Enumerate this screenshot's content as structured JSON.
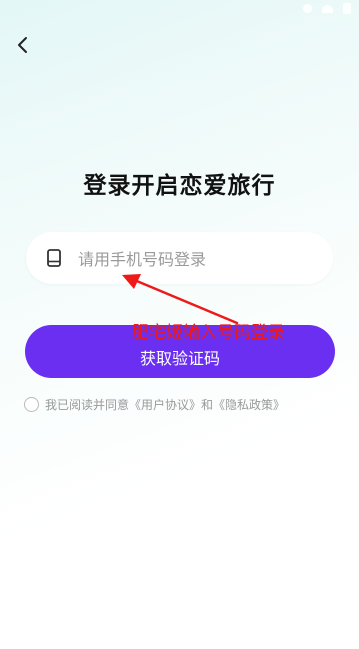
{
  "header": {
    "title": "登录开启恋爱旅行"
  },
  "phone": {
    "placeholder": "请用手机号码登录",
    "value": ""
  },
  "get_code_button": {
    "label": "获取验证码"
  },
  "annotation": {
    "text": "肥宅姬输入号码登录",
    "color": "#ee1a1a"
  },
  "agreement": {
    "prefix": "我已阅读并同意",
    "user_agreement": "《用户协议》",
    "conjunction": "和",
    "privacy_policy": "《隐私政策》"
  },
  "colors": {
    "accent": "#6a2ff0",
    "annotation": "#ee1a1a"
  },
  "icons": {
    "back": "chevron-left-icon",
    "phone": "phone-icon"
  }
}
